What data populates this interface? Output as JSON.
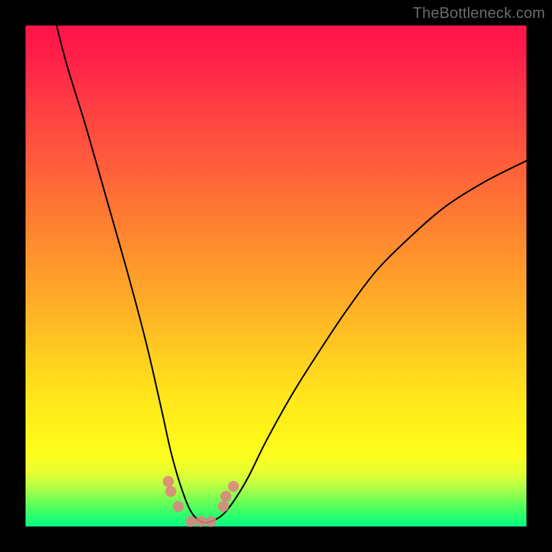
{
  "watermark": "TheBottleneck.com",
  "chart_data": {
    "type": "line",
    "title": "",
    "xlabel": "",
    "ylabel": "",
    "xlim": [
      0,
      100
    ],
    "ylim": [
      0,
      100
    ],
    "grid": false,
    "legend": false,
    "series": [
      {
        "name": "curve",
        "x": [
          5,
          8,
          12,
          16,
          20,
          24,
          27,
          29,
          31,
          33,
          35,
          37,
          40,
          44,
          48,
          53,
          58,
          64,
          70,
          77,
          84,
          92,
          100
        ],
        "y": [
          105,
          93,
          80,
          66,
          52,
          37,
          24,
          15,
          8,
          3,
          1,
          1,
          3,
          9,
          17,
          26,
          34,
          43,
          51,
          58,
          64,
          69,
          73
        ]
      }
    ],
    "markers": {
      "name": "highlight-points",
      "x": [
        28.5,
        29,
        30.5,
        33,
        35,
        37,
        39.5,
        40,
        41.5
      ],
      "y": [
        9,
        7,
        4,
        1,
        1,
        1,
        4,
        6,
        8
      ]
    },
    "background_gradient": {
      "top": "#ff1449",
      "mid": "#ffe81b",
      "bottom": "#07ff84"
    }
  }
}
